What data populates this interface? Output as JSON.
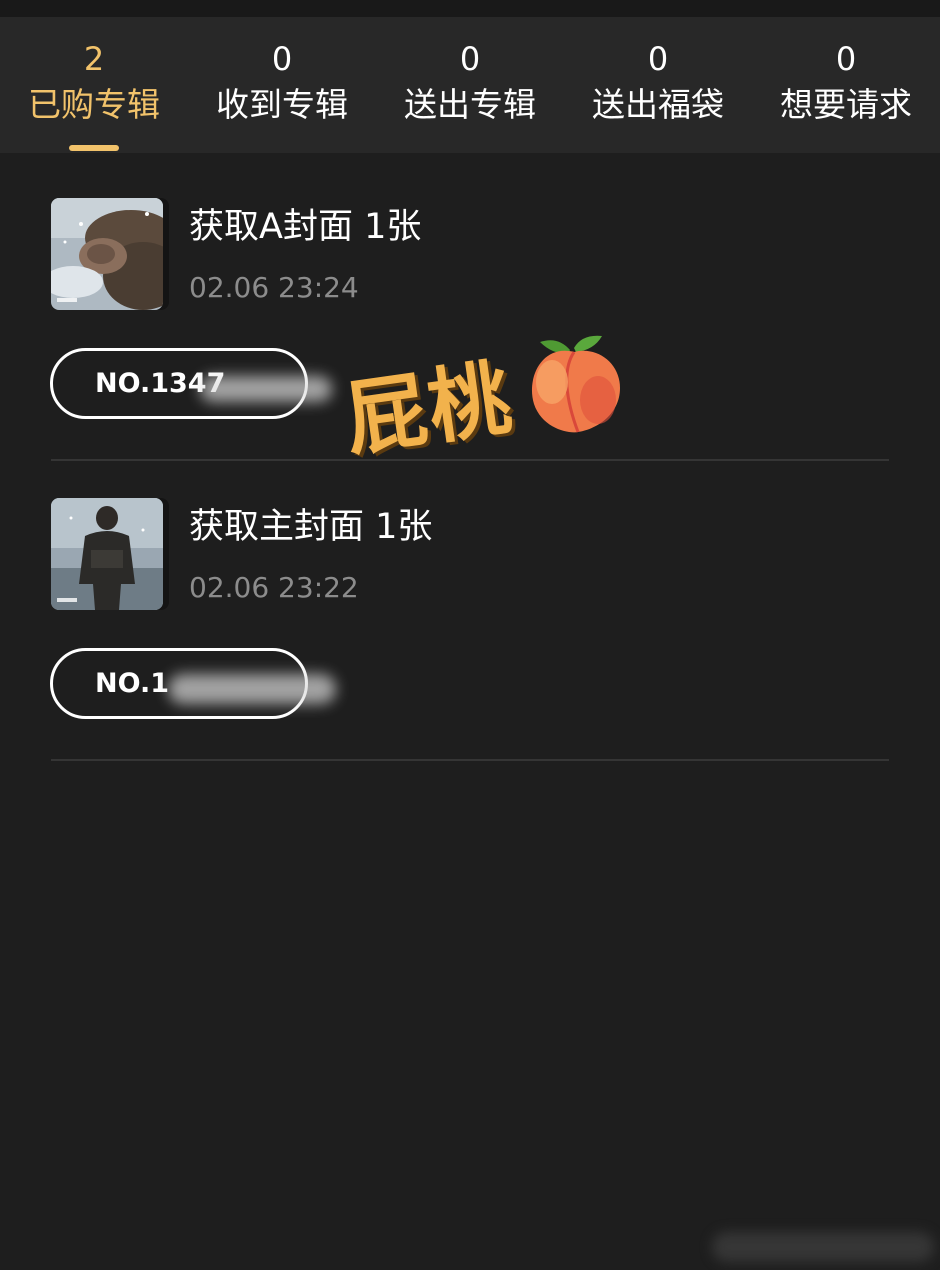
{
  "tabs": [
    {
      "count": "2",
      "label": "已购专辑",
      "active": true
    },
    {
      "count": "0",
      "label": "收到专辑"
    },
    {
      "count": "0",
      "label": "送出专辑"
    },
    {
      "count": "0",
      "label": "送出福袋"
    },
    {
      "count": "0",
      "label": "想要请求"
    }
  ],
  "items": [
    {
      "title": "获取A封面 1张",
      "time": "02.06 23:24",
      "number": "NO.1347"
    },
    {
      "title": "获取主封面 1张",
      "time": "02.06 23:22",
      "number": "NO.1"
    }
  ],
  "sticker": {
    "text": "屁桃",
    "icon": "peach-emoji"
  },
  "colors": {
    "accent": "#f2c36b",
    "background": "#1e1e1e",
    "tabbar": "#282828",
    "muted_text": "#8c8c8c",
    "sticker": "#f2b24c"
  }
}
